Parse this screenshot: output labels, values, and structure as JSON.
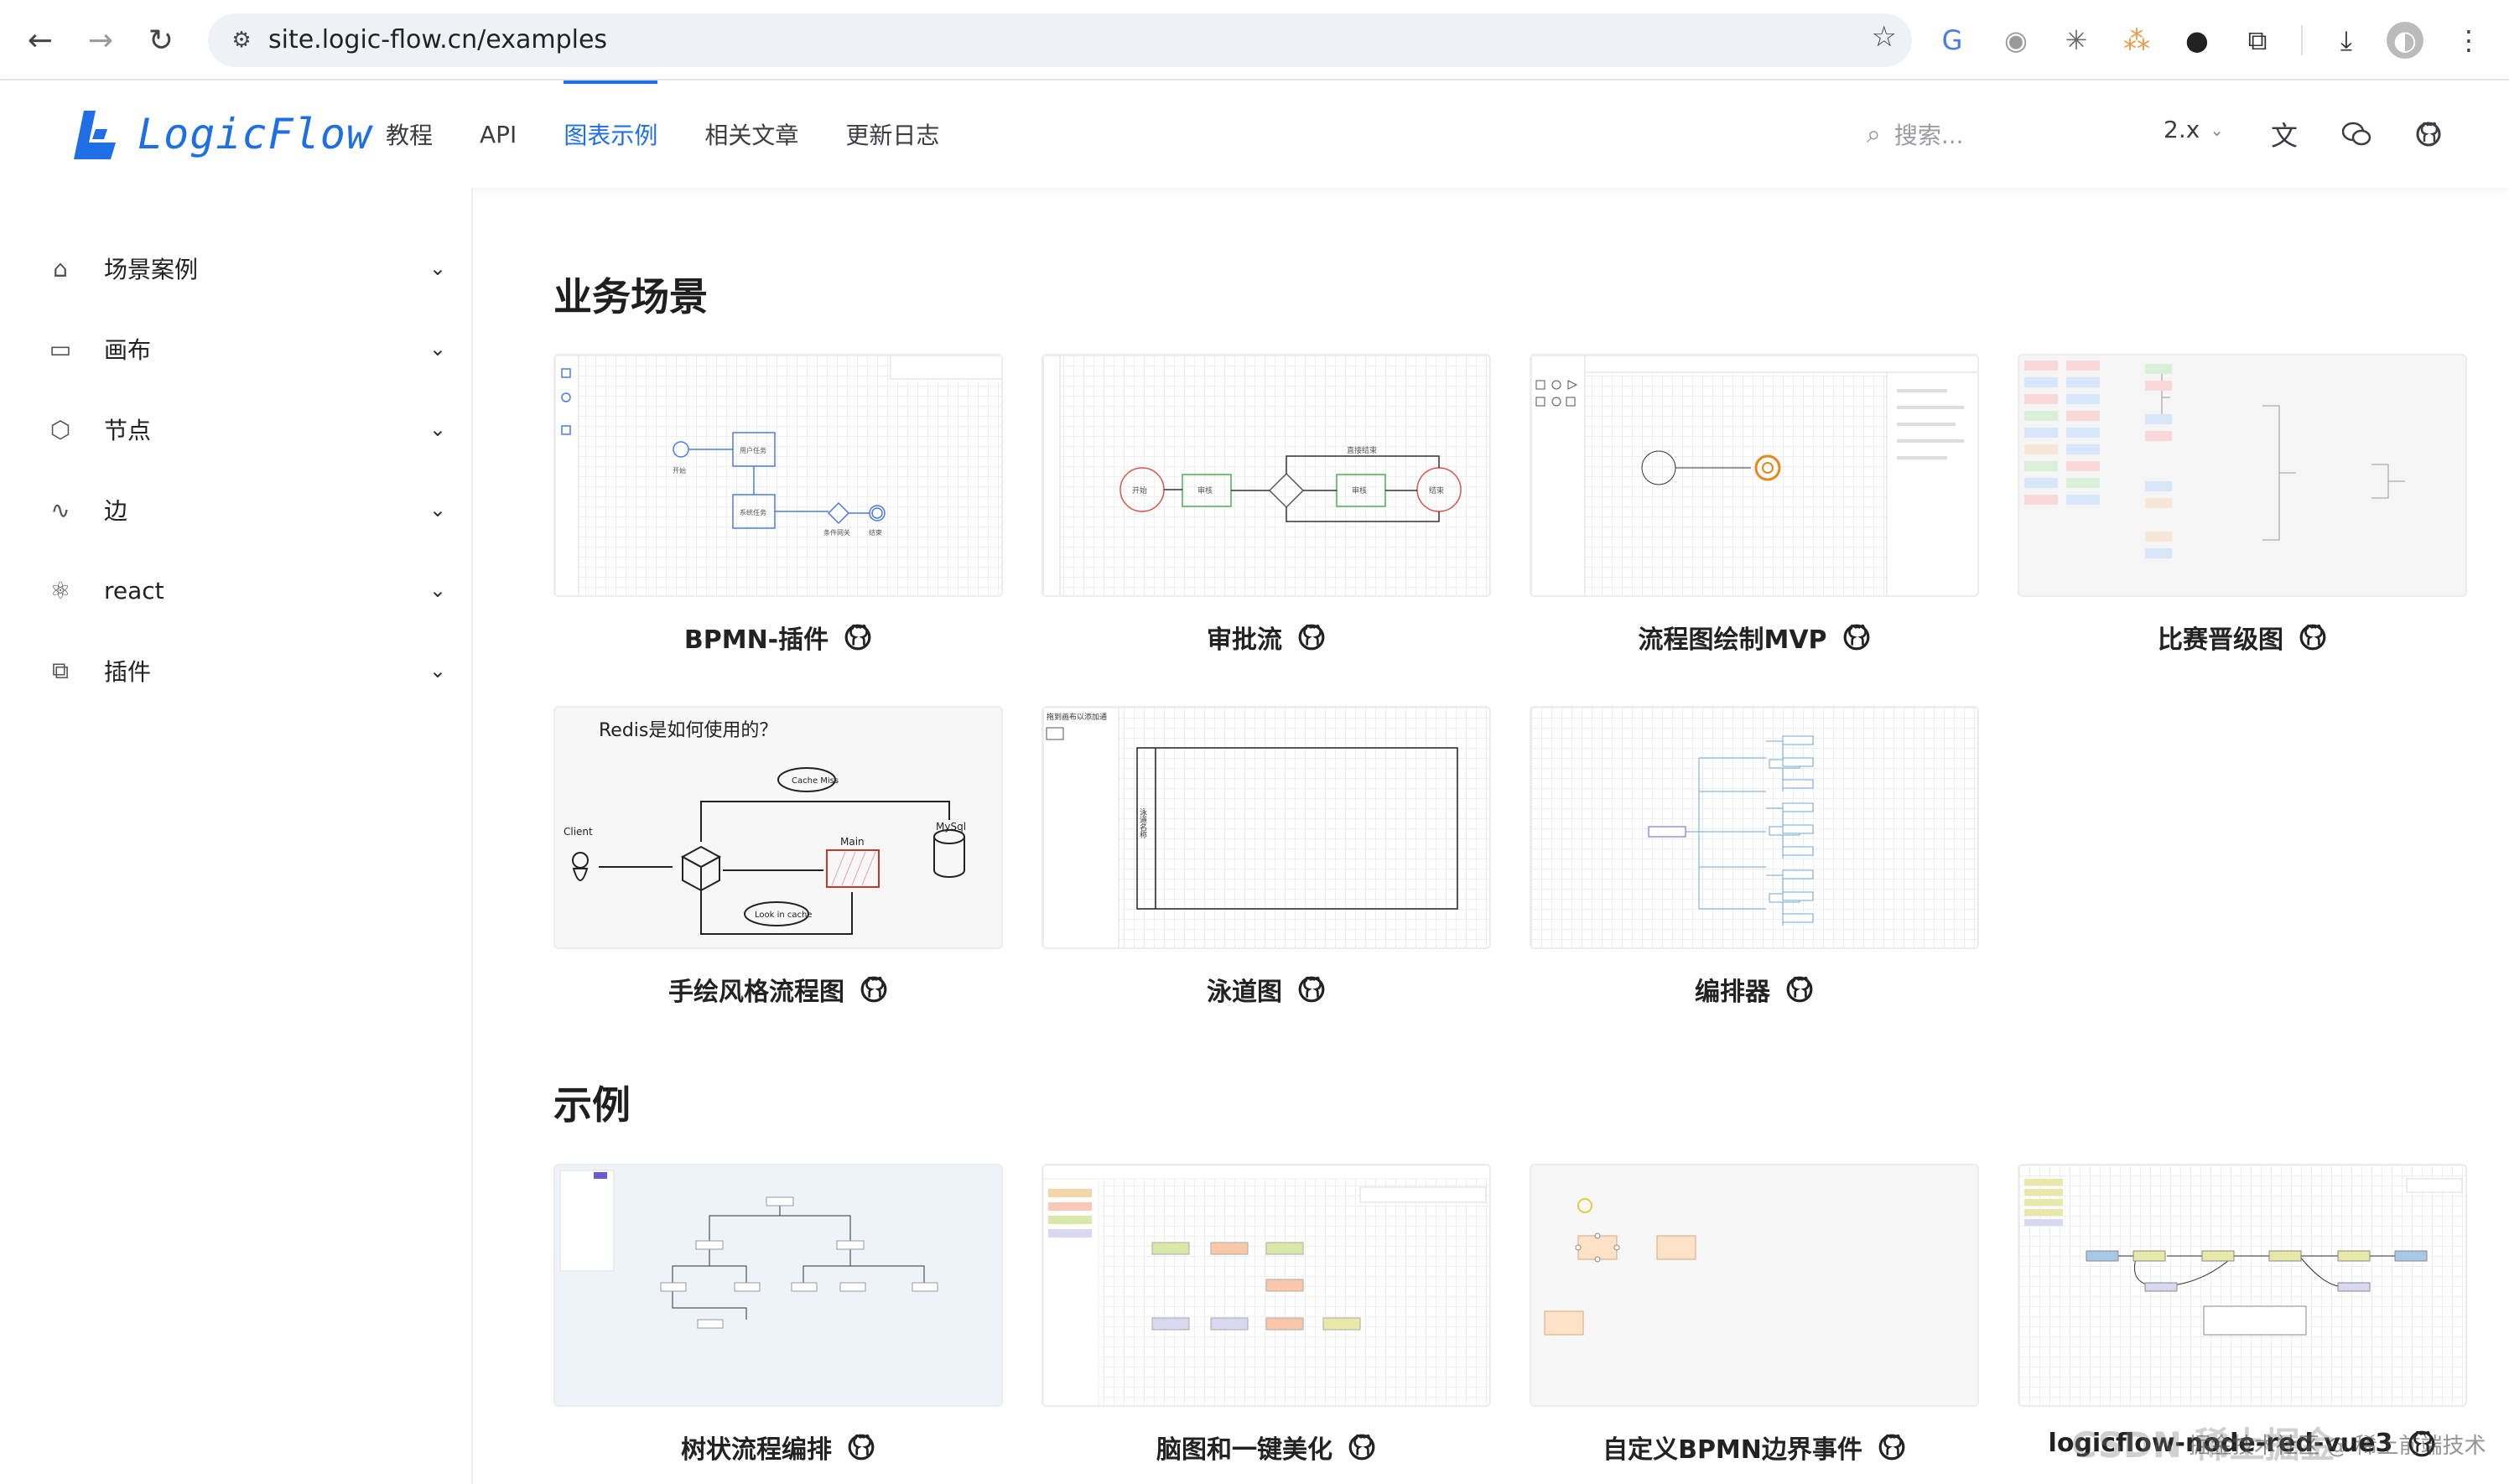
{
  "browser": {
    "url": "site.logic-flow.cn/examples",
    "back_icon": "arrow-left-icon",
    "forward_icon": "arrow-right-icon",
    "reload_icon": "reload-icon"
  },
  "header": {
    "logo_text": "LogicFlow",
    "nav": [
      "教程",
      "API",
      "图表示例",
      "相关文章",
      "更新日志"
    ],
    "active_nav": "图表示例",
    "search_placeholder": "搜索...",
    "version": "2.x",
    "accent": "#1e6fe5"
  },
  "sidebar": {
    "items": [
      {
        "label": "场景案例",
        "icon": "scene-icon"
      },
      {
        "label": "画布",
        "icon": "canvas-icon"
      },
      {
        "label": "节点",
        "icon": "node-icon"
      },
      {
        "label": "边",
        "icon": "edge-icon"
      },
      {
        "label": "react",
        "icon": "react-icon"
      },
      {
        "label": "插件",
        "icon": "plugin-icon"
      }
    ]
  },
  "sections": {
    "business": {
      "title": "业务场景",
      "cards": [
        "BPMN-插件",
        "审批流",
        "流程图绘制MVP",
        "比赛晋级图",
        "手绘风格流程图",
        "泳道图",
        "编排器"
      ]
    },
    "examples": {
      "title": "示例",
      "cards": [
        "树状流程编排",
        "脑图和一键美化",
        "自定义BPMN边界事件",
        "logicflow-node-red-vue3"
      ]
    }
  },
  "thumbs": {
    "bpmn": {
      "labels": [
        "开始",
        "用户任务",
        "系统任务",
        "条件网关",
        "结束"
      ]
    },
    "approval": {
      "labels": [
        "开始",
        "审核",
        "直接结束",
        "审核",
        "结束"
      ]
    },
    "sketch": {
      "title": "Redis是如何使用的？",
      "labels": [
        "Client",
        "Cache Miss",
        "Main",
        "MySql",
        "Look in cache"
      ]
    },
    "swimlane": {
      "labels": [
        "拖到画布以添加通",
        "泳道名称"
      ]
    }
  },
  "watermark": {
    "main": "CSDN 稀土掘金",
    "sub": "掘金技术社区 @ 稀土前端技术"
  }
}
